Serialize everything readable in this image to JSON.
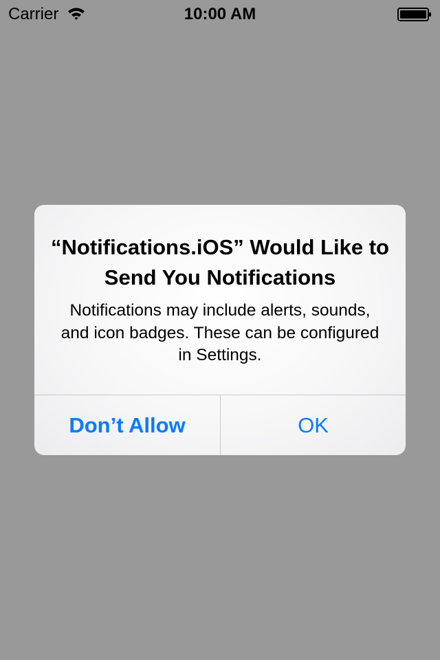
{
  "status_bar": {
    "carrier": "Carrier",
    "time": "10:00 AM",
    "wifi_icon": "wifi-icon",
    "battery_icon": "battery-icon",
    "battery_level": 1.0
  },
  "alert": {
    "title": "“Notifications.iOS” Would Like to Send You Notifications",
    "message": "Notifications may include alerts, sounds, and icon badges. These can be configured in Settings.",
    "buttons": {
      "dont_allow": "Don’t Allow",
      "ok": "OK"
    }
  },
  "colors": {
    "background": "#999999",
    "alert_background": "#f7f7f8",
    "button_text": "#0a7aff",
    "divider": "#c8c8cc"
  }
}
